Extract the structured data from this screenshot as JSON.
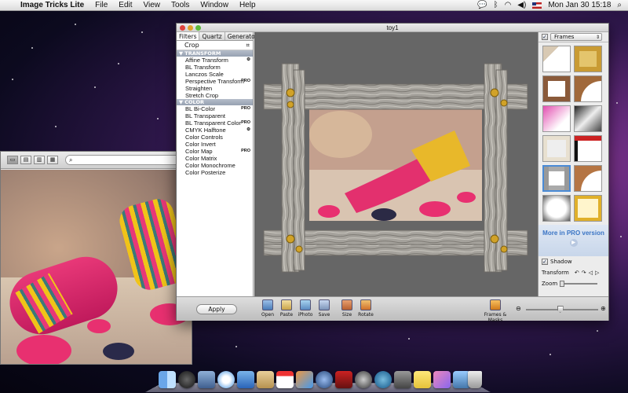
{
  "menubar": {
    "app_name": "Image Tricks Lite",
    "menus": [
      "File",
      "Edit",
      "View",
      "Tools",
      "Window",
      "Help"
    ],
    "clock": "Mon Jan 30  15:18"
  },
  "back_window": {
    "search_placeholder": ""
  },
  "main_window": {
    "title": "toy1",
    "tabs": [
      "Filters",
      "Quartz",
      "Generators"
    ],
    "crop_label": "Crop",
    "categories": {
      "transform": "TRANSFORM",
      "color": "COLOR"
    },
    "transform_items": [
      {
        "label": "Affine Transform",
        "badge": "⚙"
      },
      {
        "label": "BL Transform",
        "badge": ""
      },
      {
        "label": "Lanczos Scale",
        "badge": ""
      },
      {
        "label": "Perspective Transform",
        "badge": "PRO"
      },
      {
        "label": "Straighten",
        "badge": ""
      },
      {
        "label": "Stretch Crop",
        "badge": ""
      }
    ],
    "color_items": [
      {
        "label": "BL Bi-Color",
        "badge": "PRO"
      },
      {
        "label": "BL Transparent",
        "badge": ""
      },
      {
        "label": "BL Transparent Color",
        "badge": "PRO"
      },
      {
        "label": "CMYK Halftone",
        "badge": "⚙"
      },
      {
        "label": "Color Controls",
        "badge": ""
      },
      {
        "label": "Color Invert",
        "badge": ""
      },
      {
        "label": "Color Map",
        "badge": "PRO"
      },
      {
        "label": "Color Matrix",
        "badge": ""
      },
      {
        "label": "Color Monochrome",
        "badge": ""
      },
      {
        "label": "Color Posterize",
        "badge": ""
      }
    ],
    "right_panel": {
      "frames_label": "Frames",
      "pro_text": "More in PRO version",
      "shadow_label": "Shadow",
      "transform_label": "Transform",
      "zoom_label": "Zoom"
    },
    "bottom": {
      "apply_label": "Apply",
      "tools": [
        "Open",
        "Paste",
        "iPhoto",
        "Save",
        "Size",
        "Rotate"
      ],
      "frames_masks_label": "Frames & Masks"
    },
    "zoom_level": 0.45
  },
  "colors": {
    "accent": "#4a8bd6",
    "pro_text": "#3a74c4",
    "knit_pink": "#e83878"
  }
}
